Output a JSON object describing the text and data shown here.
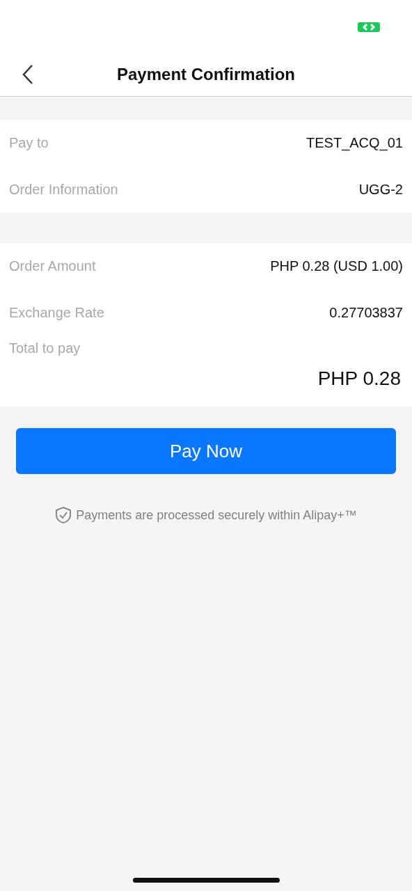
{
  "header": {
    "title": "Payment Confirmation"
  },
  "sections": [
    {
      "rows": [
        {
          "kind": "pair",
          "label": "Pay to",
          "value": "TEST_ACQ_01"
        },
        {
          "kind": "pair",
          "label": "Order Information",
          "value": "UGG-2"
        }
      ]
    },
    {
      "rows": [
        {
          "kind": "pair",
          "label": "Order Amount",
          "value": "PHP 0.28 (USD 1.00)"
        },
        {
          "kind": "pair",
          "label": "Exchange Rate",
          "value": "0.27703837"
        },
        {
          "kind": "total",
          "label": "Total to pay",
          "value": "PHP 0.28"
        }
      ]
    }
  ],
  "button": {
    "label": "Pay Now"
  },
  "security_note": "Payments are processed securely within Alipay+™"
}
